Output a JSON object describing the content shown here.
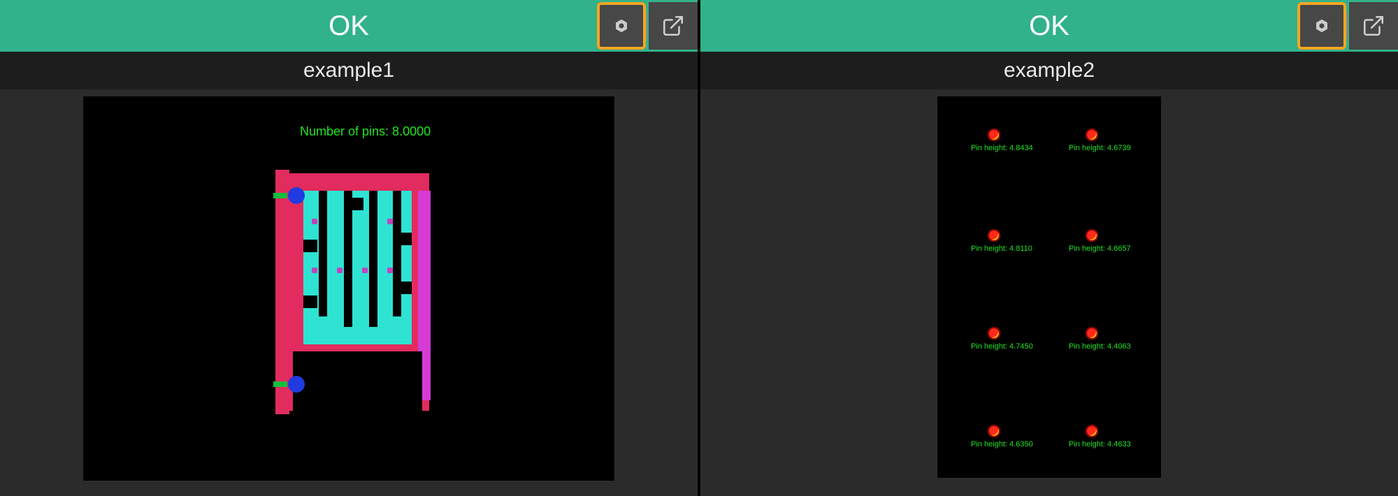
{
  "panes": [
    {
      "status": "OK",
      "title": "example1",
      "overlay_text": "Number of pins: 8.0000",
      "settings_highlighted": true
    },
    {
      "status": "OK",
      "title": "example2",
      "settings_highlighted": true,
      "pin_labels": {
        "r1c1": "Pin height: 4.8434",
        "r1c2": "Pin height: 4.6739",
        "r2c1": "Pin height: 4.8110",
        "r2c2": "Pin height: 4.6657",
        "r3c1": "Pin height: 4.7450",
        "r3c2": "Pin height: 4.4063",
        "r4c1": "Pin height: 4.6350",
        "r4c2": "Pin height: 4.4633"
      }
    }
  ],
  "icons": {
    "settings": "gear-icon",
    "popout": "external-link-icon"
  },
  "colors": {
    "status_bg": "#31b28b",
    "highlight": "#f5a623",
    "overlay_text": "#21e321"
  }
}
